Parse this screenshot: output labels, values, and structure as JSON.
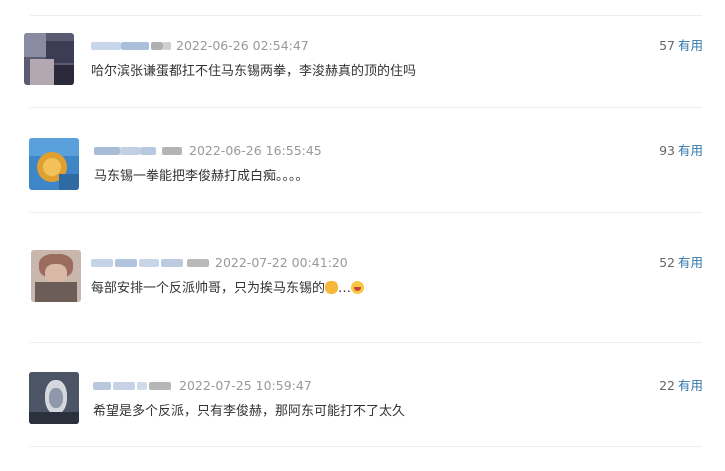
{
  "comments": [
    {
      "time": "2022-06-26 02:54:47",
      "text": "哈尔滨张谦蛋都扛不住马东锡两拳，李浚赫真的顶的住吗",
      "likes": "57",
      "useful_label": "有用"
    },
    {
      "time": "2022-06-26 16:55:45",
      "text": "马东锡一拳能把李俊赫打成白痴。。。。",
      "likes": "93",
      "useful_label": "有用"
    },
    {
      "time": "2022-07-22 00:41:20",
      "text": "每部安排一个反派帅哥，只为挨马东锡的",
      "text_suffix": "…",
      "likes": "52",
      "useful_label": "有用",
      "emojis": [
        "fist-emoji",
        "laughing-emoji"
      ]
    },
    {
      "time": "2022-07-25 10:59:47",
      "text": "希望是多个反派，只有李俊赫，那阿东可能打不了太久",
      "likes": "22",
      "useful_label": "有用"
    }
  ]
}
